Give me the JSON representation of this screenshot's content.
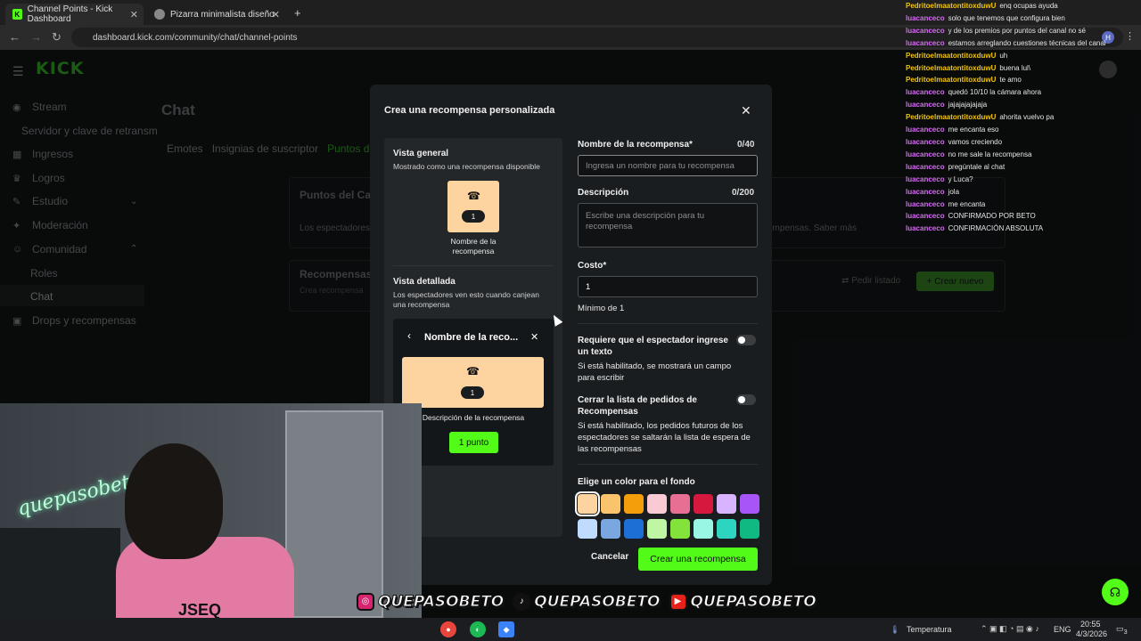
{
  "browser": {
    "tabs": [
      {
        "title": "Channel Points - Kick Dashboard",
        "active": true
      },
      {
        "title": "Pizarra minimalista diseño",
        "active": false
      }
    ],
    "url": "dashboard.kick.com/community/chat/channel-points"
  },
  "app": {
    "logo": "KICK",
    "sidebar": [
      {
        "label": "Stream",
        "icon": "stream-icon"
      },
      {
        "label": "Servidor y clave de retransm",
        "icon": ""
      },
      {
        "label": "Ingresos",
        "icon": "dollar-icon"
      },
      {
        "label": "Logros",
        "icon": "trophy-icon"
      },
      {
        "label": "Estudio",
        "icon": "studio-icon"
      },
      {
        "label": "Moderación",
        "icon": "wrench-icon"
      },
      {
        "label": "Comunidad",
        "icon": "people-icon"
      },
      {
        "label": "Roles",
        "icon": ""
      },
      {
        "label": "Chat",
        "icon": ""
      },
      {
        "label": "Drops y recompensas",
        "icon": "drops-icon"
      }
    ],
    "page_title": "Chat",
    "subtabs": [
      "Emotes",
      "Insignias de suscriptor",
      "Puntos de"
    ],
    "card1_title": "Puntos del Ca",
    "card1_text": "Los espectadores",
    "card1_text_right": "ompensas. Saber más",
    "card2_title": "Recompensas",
    "card2_sub": "Crea recompensa",
    "pedir_listado": "Pedir listado",
    "crear_nuevo": "Crear nuevo"
  },
  "modal": {
    "title": "Crea una recompensa personalizada",
    "preview": {
      "general_title": "Vista general",
      "general_sub": "Mostrado como una recompensa disponible",
      "tile_cost": "1",
      "tile_name": "Nombre de la recompensa",
      "detail_title": "Vista detallada",
      "detail_sub": "Los espectadores ven esto cuando canjean una recompensa",
      "detail_header": "Nombre de la reco...",
      "detail_cost": "1",
      "detail_desc": "Descripción de la recompensa",
      "detail_button": "1 punto"
    },
    "form": {
      "name_label": "Nombre de la recompensa*",
      "name_count": "0/40",
      "name_placeholder": "Ingresa un nombre para tu recompensa",
      "desc_label": "Descripción",
      "desc_count": "0/200",
      "desc_placeholder": "Escribe una descripción para tu recompensa",
      "cost_label": "Costo*",
      "cost_value": "1",
      "cost_min": "Mínimo de 1",
      "require_text_label": "Requiere que el espectador ingrese un texto",
      "require_text_help": "Si está habilitado, se mostrará un campo para escribir",
      "close_list_label": "Cerrar la lista de pedidos de Recompensas",
      "close_list_help": "Si está habilitado, los pedidos futuros de los espectadores se saltarán la lista de espera de las recompensas",
      "color_label": "Elige un color para el fondo",
      "colors": [
        "#fdd49f",
        "#f9c46b",
        "#f59e0b",
        "#f9c9d4",
        "#e76f94",
        "#d6183f",
        "#d8b4fe",
        "#a855f7",
        "#bfdbfe",
        "#7aa7e0",
        "#1d6fd6",
        "#bef6a3",
        "#84e33a",
        "#99f6e4",
        "#2dd4bf",
        "#10b981"
      ],
      "selected_color": 0
    },
    "cancel": "Cancelar",
    "create": "Crear una recompensa"
  },
  "chat_overlay": [
    {
      "user": "PedritoelmaatontitoxduwU",
      "msg": "enq ocupas ayuda",
      "color": "#f1c40f"
    },
    {
      "user": "luacanceco",
      "msg": "solo que tenemos que configura bien",
      "color": "#d46cf0"
    },
    {
      "user": "luacanceco",
      "msg": "y de los premios por puntos del canal no sé",
      "color": "#d46cf0"
    },
    {
      "user": "luacanceco",
      "msg": "estamos arreglando cuestiones técnicas del canal",
      "color": "#d46cf0"
    },
    {
      "user": "PedritoelmaatontitoxduwU",
      "msg": "uh",
      "color": "#f1c40f"
    },
    {
      "user": "PedritoelmaatontitoxduwU",
      "msg": "buena lul\\",
      "color": "#f1c40f"
    },
    {
      "user": "PedritoelmaatontitoxduwU",
      "msg": "te amo",
      "color": "#f1c40f"
    },
    {
      "user": "luacanceco",
      "msg": "quedó 10/10 la cámara ahora",
      "color": "#d46cf0"
    },
    {
      "user": "luacanceco",
      "msg": "jajajajajajaja",
      "color": "#d46cf0"
    },
    {
      "user": "PedritoelmaatontitoxduwU",
      "msg": "ahorita vuelvo pa",
      "color": "#f1c40f"
    },
    {
      "user": "luacanceco",
      "msg": "me encanta eso",
      "color": "#d46cf0"
    },
    {
      "user": "luacanceco",
      "msg": "vamos creciendo",
      "color": "#d46cf0"
    },
    {
      "user": "luacanceco",
      "msg": "no me sale la recompensa",
      "color": "#d46cf0"
    },
    {
      "user": "luacanceco",
      "msg": "pregúntale al chat",
      "color": "#d46cf0"
    },
    {
      "user": "luacanceco",
      "msg": "y Luca?",
      "color": "#d46cf0"
    },
    {
      "user": "luacanceco",
      "msg": "jola",
      "color": "#d46cf0"
    },
    {
      "user": "luacanceco",
      "msg": "me encanta",
      "color": "#d46cf0"
    },
    {
      "user": "luacanceco",
      "msg": "CONFIRMADO POR BETO",
      "color": "#d46cf0"
    },
    {
      "user": "luacanceco",
      "msg": "CONFIRMACIÓN ABSOLUTA",
      "color": "#d46cf0"
    }
  ],
  "stream_overlay": {
    "neon_text": "quepasobeto",
    "handles": [
      "QUEPASOBETO",
      "QUEPASOBETO",
      "QUEPASOBETO"
    ],
    "jersey": "JSEQ"
  },
  "taskbar": {
    "weather": "Temperatura",
    "lang": "ENG",
    "time": "20:55",
    "date": "4/3/2026",
    "notif": "3"
  }
}
